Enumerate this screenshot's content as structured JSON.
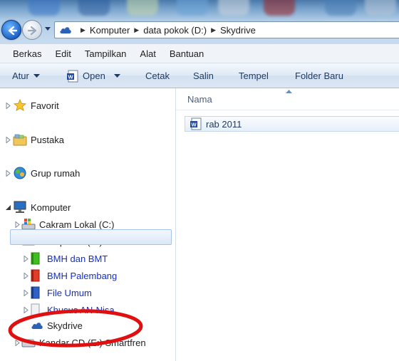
{
  "address_bar": {
    "breadcrumbs": [
      "Komputer",
      "data pokok (D:)",
      "Skydrive"
    ]
  },
  "menu_bar": {
    "items": [
      "Berkas",
      "Edit",
      "Tampilkan",
      "Alat",
      "Bantuan"
    ]
  },
  "command_bar": {
    "organize": "Atur",
    "open": "Open",
    "print": "Cetak",
    "copy": "Salin",
    "paste": "Tempel",
    "new_folder": "Folder Baru"
  },
  "navigation_tree": {
    "favorites": "Favorit",
    "libraries": "Pustaka",
    "homegroup": "Grup rumah",
    "computer": "Komputer",
    "local_disk": "Cakram Lokal (C:)",
    "data_drive": "data pokok (D:)",
    "folders": [
      "BMH dan BMT",
      "BMH Palembang",
      "File Umum",
      "Khusus AN-Nisa"
    ],
    "selected": "Skydrive",
    "cd_drive": "Kandar CD (E:) Smartfren"
  },
  "content_pane": {
    "column_name": "Nama",
    "files": [
      {
        "name": "rab 2011",
        "type": "word-document"
      }
    ]
  },
  "colors": {
    "selection_bg": "#dbe8f8",
    "annotation_ellipse": "#e01010",
    "folder_link_blue": "#1530c8"
  }
}
